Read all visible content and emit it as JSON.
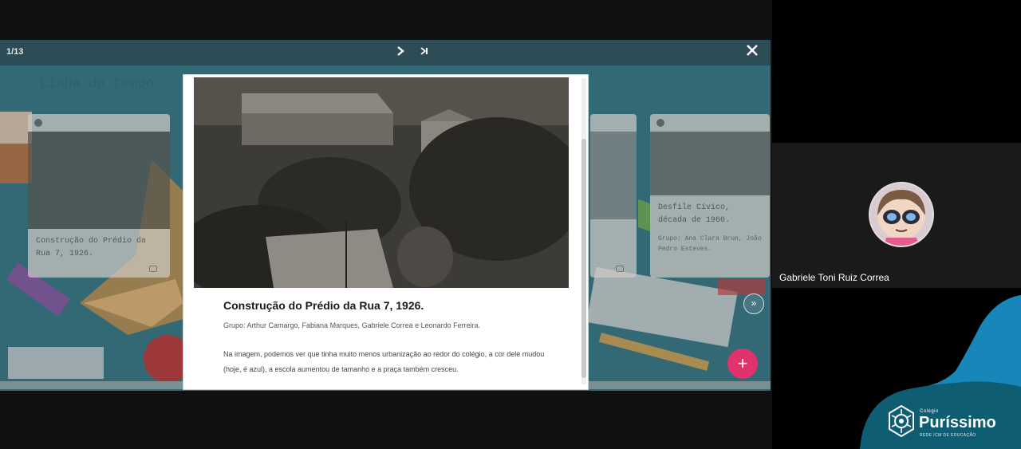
{
  "presentation": {
    "counter": "1/13",
    "next_icon": "chevron-right-icon",
    "last_icon": "skip-to-end-icon",
    "close_icon": "close-icon",
    "board_title": "Linha do tempo"
  },
  "cards": [
    {
      "caption": "Construção do Prédio da Rua 7, 1926."
    },
    {
      "caption": "Desfile Cívico, década de 1960.",
      "group": "Grupo: Ana Clara Brun, João Pedro Esteves."
    }
  ],
  "modal": {
    "title": "Construção do Prédio da Rua 7, 1926.",
    "group": "Grupo: Arthur Camargo, Fabiana Marques, Gabriele Correa e Leonardo Ferreira.",
    "description": "Na imagem, podemos ver que tinha muito menos urbanização ao redor do colégio, a cor dele mudou (hoje, é azul), a escola aumentou de tamanho e a praça também cresceu."
  },
  "participant": {
    "name": "Gabriele Toni Ruiz Correa"
  },
  "logo": {
    "small": "Colégio",
    "main": "Puríssimo",
    "tagline": "REDE ICM DE EDUCAÇÃO"
  },
  "colors": {
    "board": "#3f7f8f",
    "accent_pink": "#e0326c",
    "logo_teal": "#0e5d73",
    "logo_blue": "#1687b8"
  }
}
